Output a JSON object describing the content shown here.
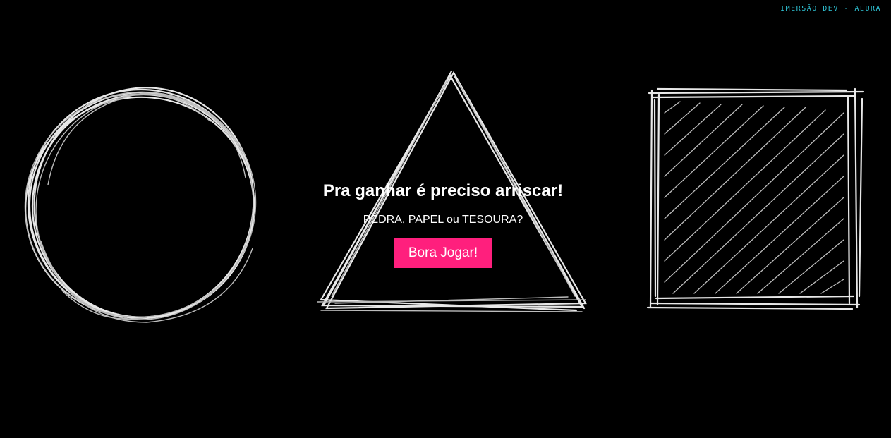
{
  "brand": {
    "text": "IMERSÃO DEV - ALURA",
    "color": "#2fc4d6"
  },
  "hero": {
    "title": "Pra ganhar é preciso arriscar!",
    "subtitle": "PEDRA, PAPEL ou TESOURA?",
    "button_label": "Bora Jogar!",
    "button_color": "#ff1f7d"
  },
  "shapes": [
    {
      "name": "circle",
      "icon": "sketch-circle-icon"
    },
    {
      "name": "triangle",
      "icon": "sketch-triangle-icon"
    },
    {
      "name": "square",
      "icon": "sketch-square-icon"
    }
  ]
}
